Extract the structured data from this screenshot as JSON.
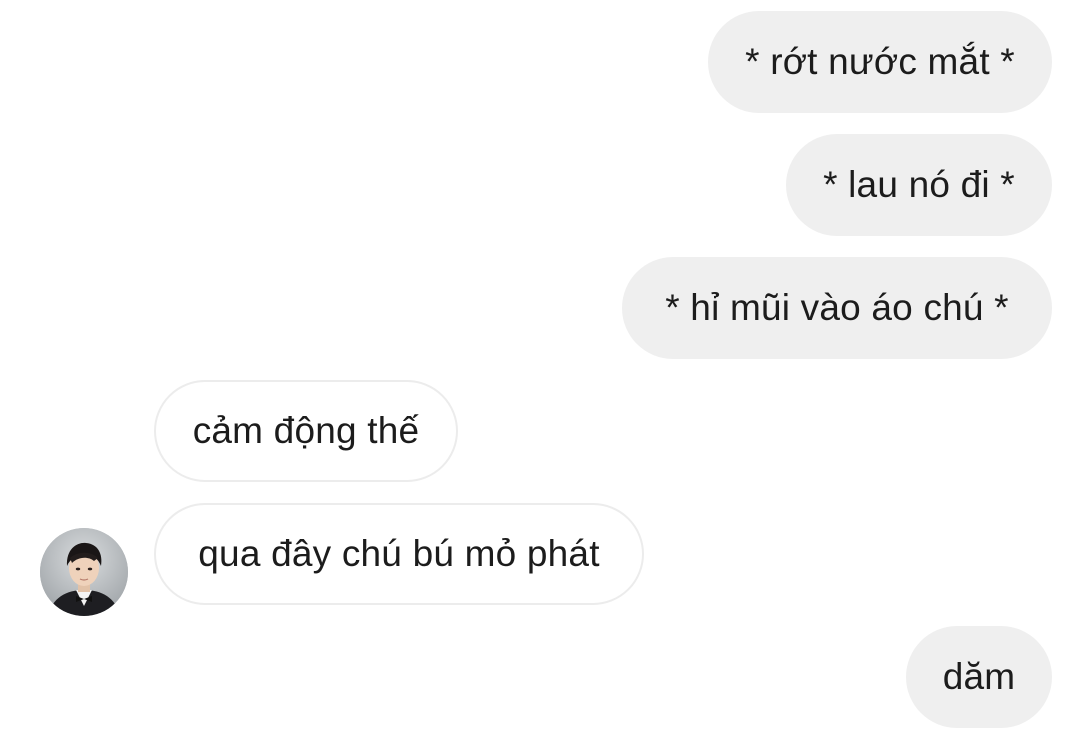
{
  "chat": {
    "messages": [
      {
        "sender": "me",
        "text": "* rớt nước mắt *"
      },
      {
        "sender": "me",
        "text": "* lau nó đi *"
      },
      {
        "sender": "me",
        "text": "* hỉ mũi vào áo chú *"
      },
      {
        "sender": "other",
        "text": "cảm động thế"
      },
      {
        "sender": "other",
        "text": "qua đây chú bú mỏ phát"
      },
      {
        "sender": "me",
        "text": "dăm"
      }
    ],
    "contact_avatar": "contact-avatar-photo"
  },
  "colors": {
    "outgoing_bubble": "#efefef",
    "incoming_bubble": "#ffffff",
    "incoming_border": "#ececec",
    "text": "#1c1c1c"
  }
}
